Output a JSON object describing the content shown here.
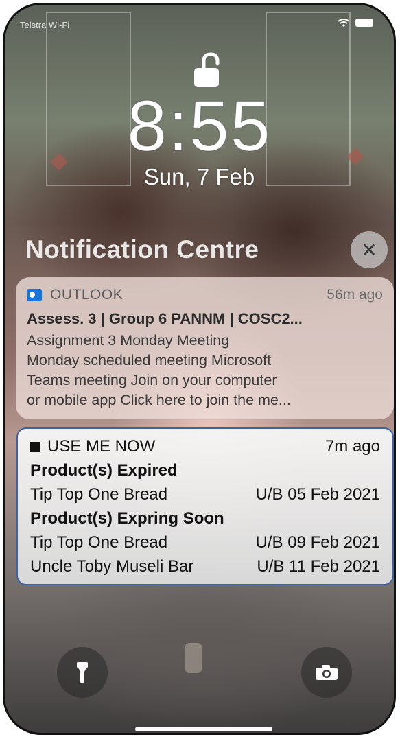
{
  "status_bar": {
    "carrier": "Telstra Wi-Fi"
  },
  "lockscreen": {
    "time": "8:55",
    "date": "Sun, 7 Feb"
  },
  "notification_centre": {
    "title": "Notification Centre",
    "close_symbol": "✕"
  },
  "outlook_notification": {
    "app": "OUTLOOK",
    "time_ago": "56m ago",
    "subject": "Assess. 3 | Group 6 PANNM | COSC2...",
    "body_lines": [
      "Assignment 3 Monday Meeting",
      "Monday scheduled meeting Microsoft",
      "Teams meeting Join on your computer",
      "or mobile app Click here to join the me..."
    ],
    "icon": "outlook-app-icon"
  },
  "useme_notification": {
    "app": "USE ME NOW",
    "time_ago": "7m ago",
    "expired_heading": "Product(s) Expired",
    "expired_items": [
      {
        "name": "Tip Top One Bread",
        "date": "U/B 05 Feb 2021"
      }
    ],
    "expiring_heading": "Product(s) Expring Soon",
    "expiring_items": [
      {
        "name": "Tip Top One Bread",
        "date": "U/B 09 Feb 2021"
      },
      {
        "name": "Uncle Toby Museli Bar",
        "date": "U/B 11 Feb 2021"
      }
    ],
    "border_color": "#3b63a5"
  },
  "quick_actions": {
    "left_icon": "flashlight-icon",
    "right_icon": "camera-icon"
  }
}
